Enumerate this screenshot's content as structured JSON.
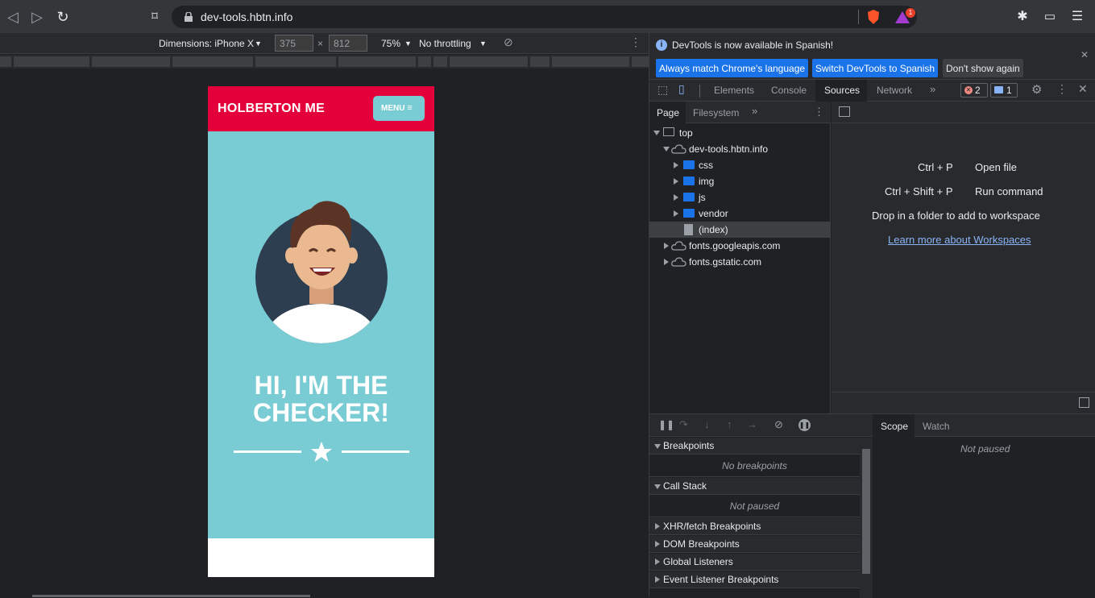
{
  "browser": {
    "url": "dev-tools.hbtn.info",
    "notification_count": "1"
  },
  "device_toolbar": {
    "dimensions_label": "Dimensions: iPhone X",
    "width": "375",
    "height": "812",
    "times": "×",
    "zoom": "75%",
    "throttling": "No throttling"
  },
  "page": {
    "brand": "HOLBERTON ME",
    "menu_label": "MENU",
    "hero_title_line1": "HI, I'M THE",
    "hero_title_line2": "CHECKER!"
  },
  "devtools": {
    "info_text": "DevTools is now available in Spanish!",
    "btn_match": "Always match Chrome's language",
    "btn_switch": "Switch DevTools to Spanish",
    "btn_dont_show": "Don't show again",
    "tabs": [
      "Elements",
      "Console",
      "Sources",
      "Network"
    ],
    "active_tab": "Sources",
    "errors": "2",
    "messages": "1",
    "subtabs": [
      "Page",
      "Filesystem"
    ],
    "tree": {
      "top": "top",
      "domain": "dev-tools.hbtn.info",
      "folders": [
        "css",
        "img",
        "js",
        "vendor"
      ],
      "index": "(index)",
      "googleapis": "fonts.googleapis.com",
      "gstatic": "fonts.gstatic.com"
    },
    "shortcuts": {
      "open_key": "Ctrl + P",
      "open_label": "Open file",
      "run_key": "Ctrl + Shift + P",
      "run_label": "Run command",
      "drop_text": "Drop in a folder to add to workspace",
      "learn_more": "Learn more about Workspaces"
    },
    "debugger": {
      "breakpoints": "Breakpoints",
      "no_breakpoints": "No breakpoints",
      "call_stack": "Call Stack",
      "not_paused": "Not paused",
      "xhr": "XHR/fetch Breakpoints",
      "dom": "DOM Breakpoints",
      "global": "Global Listeners",
      "event": "Event Listener Breakpoints",
      "scope_tab": "Scope",
      "watch_tab": "Watch",
      "scope_status": "Not paused"
    }
  },
  "colors": {
    "brand_red": "#e4003a",
    "hero_teal": "#79ccd3",
    "devtools_blue": "#1a73e8"
  }
}
